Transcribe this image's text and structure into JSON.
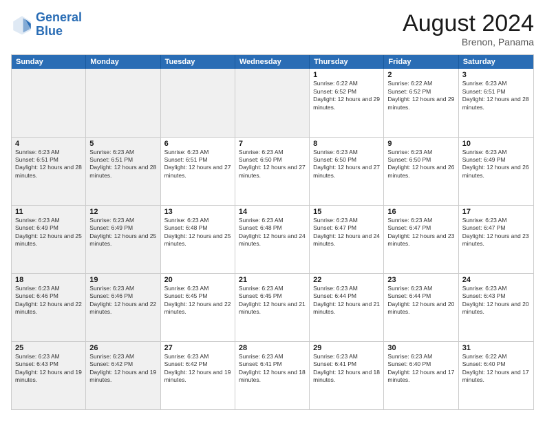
{
  "header": {
    "logo_line1": "General",
    "logo_line2": "Blue",
    "month_title": "August 2024",
    "location": "Brenon, Panama"
  },
  "weekdays": [
    "Sunday",
    "Monday",
    "Tuesday",
    "Wednesday",
    "Thursday",
    "Friday",
    "Saturday"
  ],
  "rows": [
    [
      {
        "day": "",
        "info": "",
        "shaded": true
      },
      {
        "day": "",
        "info": "",
        "shaded": true
      },
      {
        "day": "",
        "info": "",
        "shaded": true
      },
      {
        "day": "",
        "info": "",
        "shaded": true
      },
      {
        "day": "1",
        "info": "Sunrise: 6:22 AM\nSunset: 6:52 PM\nDaylight: 12 hours and 29 minutes.",
        "shaded": false
      },
      {
        "day": "2",
        "info": "Sunrise: 6:22 AM\nSunset: 6:52 PM\nDaylight: 12 hours and 29 minutes.",
        "shaded": false
      },
      {
        "day": "3",
        "info": "Sunrise: 6:23 AM\nSunset: 6:51 PM\nDaylight: 12 hours and 28 minutes.",
        "shaded": false
      }
    ],
    [
      {
        "day": "4",
        "info": "Sunrise: 6:23 AM\nSunset: 6:51 PM\nDaylight: 12 hours and 28 minutes.",
        "shaded": true
      },
      {
        "day": "5",
        "info": "Sunrise: 6:23 AM\nSunset: 6:51 PM\nDaylight: 12 hours and 28 minutes.",
        "shaded": true
      },
      {
        "day": "6",
        "info": "Sunrise: 6:23 AM\nSunset: 6:51 PM\nDaylight: 12 hours and 27 minutes.",
        "shaded": false
      },
      {
        "day": "7",
        "info": "Sunrise: 6:23 AM\nSunset: 6:50 PM\nDaylight: 12 hours and 27 minutes.",
        "shaded": false
      },
      {
        "day": "8",
        "info": "Sunrise: 6:23 AM\nSunset: 6:50 PM\nDaylight: 12 hours and 27 minutes.",
        "shaded": false
      },
      {
        "day": "9",
        "info": "Sunrise: 6:23 AM\nSunset: 6:50 PM\nDaylight: 12 hours and 26 minutes.",
        "shaded": false
      },
      {
        "day": "10",
        "info": "Sunrise: 6:23 AM\nSunset: 6:49 PM\nDaylight: 12 hours and 26 minutes.",
        "shaded": false
      }
    ],
    [
      {
        "day": "11",
        "info": "Sunrise: 6:23 AM\nSunset: 6:49 PM\nDaylight: 12 hours and 25 minutes.",
        "shaded": true
      },
      {
        "day": "12",
        "info": "Sunrise: 6:23 AM\nSunset: 6:49 PM\nDaylight: 12 hours and 25 minutes.",
        "shaded": true
      },
      {
        "day": "13",
        "info": "Sunrise: 6:23 AM\nSunset: 6:48 PM\nDaylight: 12 hours and 25 minutes.",
        "shaded": false
      },
      {
        "day": "14",
        "info": "Sunrise: 6:23 AM\nSunset: 6:48 PM\nDaylight: 12 hours and 24 minutes.",
        "shaded": false
      },
      {
        "day": "15",
        "info": "Sunrise: 6:23 AM\nSunset: 6:47 PM\nDaylight: 12 hours and 24 minutes.",
        "shaded": false
      },
      {
        "day": "16",
        "info": "Sunrise: 6:23 AM\nSunset: 6:47 PM\nDaylight: 12 hours and 23 minutes.",
        "shaded": false
      },
      {
        "day": "17",
        "info": "Sunrise: 6:23 AM\nSunset: 6:47 PM\nDaylight: 12 hours and 23 minutes.",
        "shaded": false
      }
    ],
    [
      {
        "day": "18",
        "info": "Sunrise: 6:23 AM\nSunset: 6:46 PM\nDaylight: 12 hours and 22 minutes.",
        "shaded": true
      },
      {
        "day": "19",
        "info": "Sunrise: 6:23 AM\nSunset: 6:46 PM\nDaylight: 12 hours and 22 minutes.",
        "shaded": true
      },
      {
        "day": "20",
        "info": "Sunrise: 6:23 AM\nSunset: 6:45 PM\nDaylight: 12 hours and 22 minutes.",
        "shaded": false
      },
      {
        "day": "21",
        "info": "Sunrise: 6:23 AM\nSunset: 6:45 PM\nDaylight: 12 hours and 21 minutes.",
        "shaded": false
      },
      {
        "day": "22",
        "info": "Sunrise: 6:23 AM\nSunset: 6:44 PM\nDaylight: 12 hours and 21 minutes.",
        "shaded": false
      },
      {
        "day": "23",
        "info": "Sunrise: 6:23 AM\nSunset: 6:44 PM\nDaylight: 12 hours and 20 minutes.",
        "shaded": false
      },
      {
        "day": "24",
        "info": "Sunrise: 6:23 AM\nSunset: 6:43 PM\nDaylight: 12 hours and 20 minutes.",
        "shaded": false
      }
    ],
    [
      {
        "day": "25",
        "info": "Sunrise: 6:23 AM\nSunset: 6:43 PM\nDaylight: 12 hours and 19 minutes.",
        "shaded": true
      },
      {
        "day": "26",
        "info": "Sunrise: 6:23 AM\nSunset: 6:42 PM\nDaylight: 12 hours and 19 minutes.",
        "shaded": true
      },
      {
        "day": "27",
        "info": "Sunrise: 6:23 AM\nSunset: 6:42 PM\nDaylight: 12 hours and 19 minutes.",
        "shaded": false
      },
      {
        "day": "28",
        "info": "Sunrise: 6:23 AM\nSunset: 6:41 PM\nDaylight: 12 hours and 18 minutes.",
        "shaded": false
      },
      {
        "day": "29",
        "info": "Sunrise: 6:23 AM\nSunset: 6:41 PM\nDaylight: 12 hours and 18 minutes.",
        "shaded": false
      },
      {
        "day": "30",
        "info": "Sunrise: 6:23 AM\nSunset: 6:40 PM\nDaylight: 12 hours and 17 minutes.",
        "shaded": false
      },
      {
        "day": "31",
        "info": "Sunrise: 6:22 AM\nSunset: 6:40 PM\nDaylight: 12 hours and 17 minutes.",
        "shaded": false
      }
    ]
  ]
}
